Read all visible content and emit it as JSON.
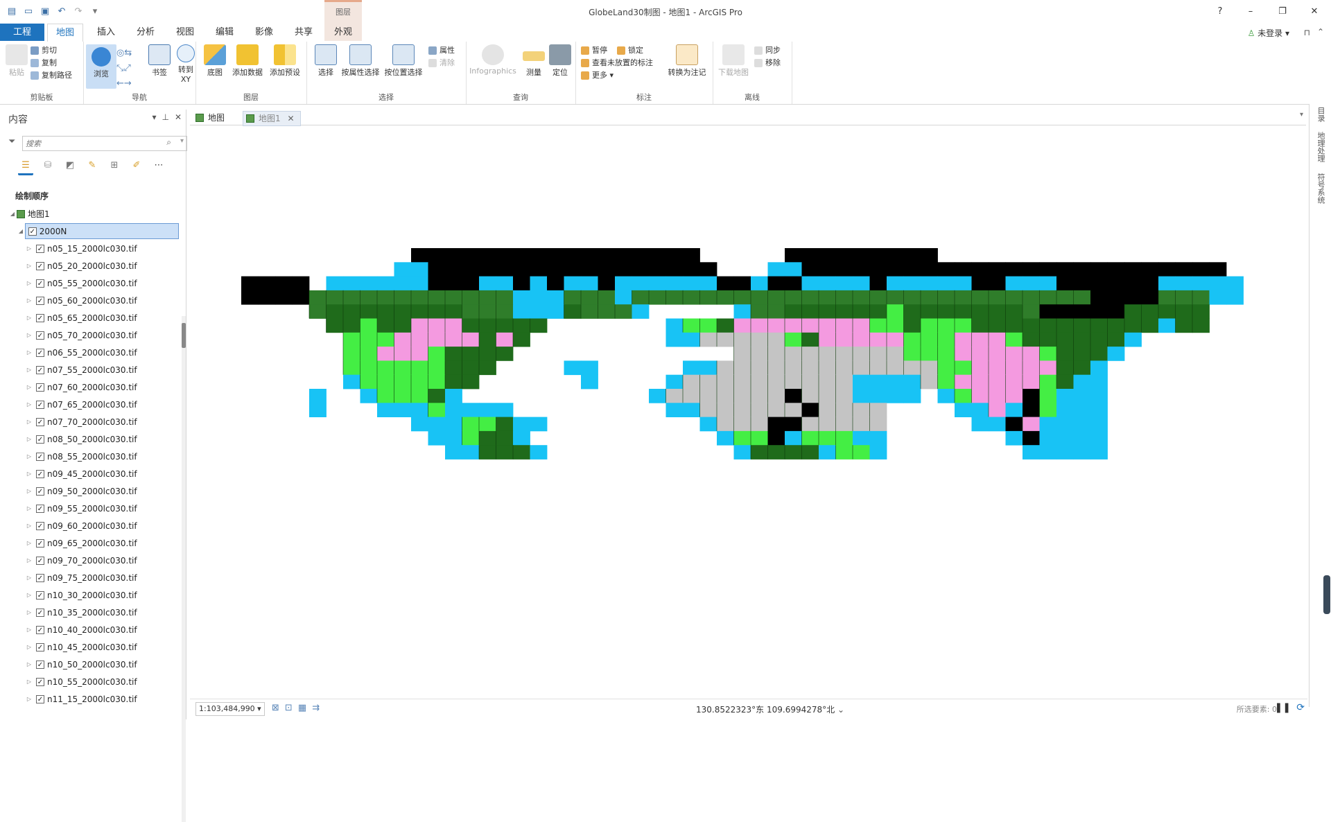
{
  "window": {
    "title": "GlobeLand30制图 - 地图1 - ArcGIS Pro",
    "context_group": "图层",
    "help": "?",
    "minimize": "–",
    "restore": "❐",
    "close": "✕"
  },
  "tabs": [
    "工程",
    "地图",
    "插入",
    "分析",
    "视图",
    "编辑",
    "影像",
    "共享",
    "外观"
  ],
  "user": {
    "label": "未登录 ▾"
  },
  "ribbon": {
    "clipboard": {
      "paste": "粘贴",
      "cut": "剪切",
      "copy": "复制",
      "copy_path": "复制路径",
      "label": "剪贴板"
    },
    "navigate": {
      "explore": "浏览",
      "bookmarks": "书签",
      "goto": "转到",
      "goto2": "XY",
      "label": "导航"
    },
    "layer": {
      "basemap": "底图",
      "add_data": "添加数据",
      "add_preset": "添加预设",
      "label": "图层"
    },
    "selection": {
      "select": "选择",
      "by_attr": "按属性选择",
      "by_loc": "按位置选择",
      "attributes": "属性",
      "clear": "清除",
      "label": "选择"
    },
    "inquiry": {
      "infographics": "Infographics",
      "measure": "测量",
      "locate": "定位",
      "label": "查询"
    },
    "labeling": {
      "pause": "暂停",
      "lock": "锁定",
      "unplaced": "查看未放置的标注",
      "more": "更多 ▾",
      "convert": "转换为注记",
      "label": "标注"
    },
    "offline": {
      "download": "下载地图",
      "sync": "同步",
      "remove": "移除",
      "label": "离线"
    }
  },
  "contents": {
    "title": "内容",
    "search_placeholder": "搜索",
    "drawing_order": "绘制顺序",
    "map_name": "地图1",
    "group_layer": "2000N",
    "layers": [
      "n05_15_2000lc030.tif",
      "n05_20_2000lc030.tif",
      "n05_55_2000lc030.tif",
      "n05_60_2000lc030.tif",
      "n05_65_2000lc030.tif",
      "n05_70_2000lc030.tif",
      "n06_55_2000lc030.tif",
      "n07_55_2000lc030.tif",
      "n07_60_2000lc030.tif",
      "n07_65_2000lc030.tif",
      "n07_70_2000lc030.tif",
      "n08_50_2000lc030.tif",
      "n08_55_2000lc030.tif",
      "n09_45_2000lc030.tif",
      "n09_50_2000lc030.tif",
      "n09_55_2000lc030.tif",
      "n09_60_2000lc030.tif",
      "n09_65_2000lc030.tif",
      "n09_70_2000lc030.tif",
      "n09_75_2000lc030.tif",
      "n10_30_2000lc030.tif",
      "n10_35_2000lc030.tif",
      "n10_40_2000lc030.tif",
      "n10_45_2000lc030.tif",
      "n10_50_2000lc030.tif",
      "n10_55_2000lc030.tif",
      "n11_15_2000lc030.tif"
    ]
  },
  "map_tabs": [
    "地图",
    "地图1"
  ],
  "right_panels": [
    "目录",
    "地理处理",
    "符号系统"
  ],
  "status": {
    "scale": "1:103,484,990 ▾",
    "coordinates": "130.8522323°东 109.6994278°北",
    "selected": "所选要素: 0"
  },
  "colors": {
    "water": "#18c3f5",
    "nodata": "#000000",
    "cultivated": "#f49ae0",
    "forest": "#1f6b1b",
    "grass": "#44ee44",
    "bare": "#c4c4c4",
    "accent": "#1e73be"
  }
}
